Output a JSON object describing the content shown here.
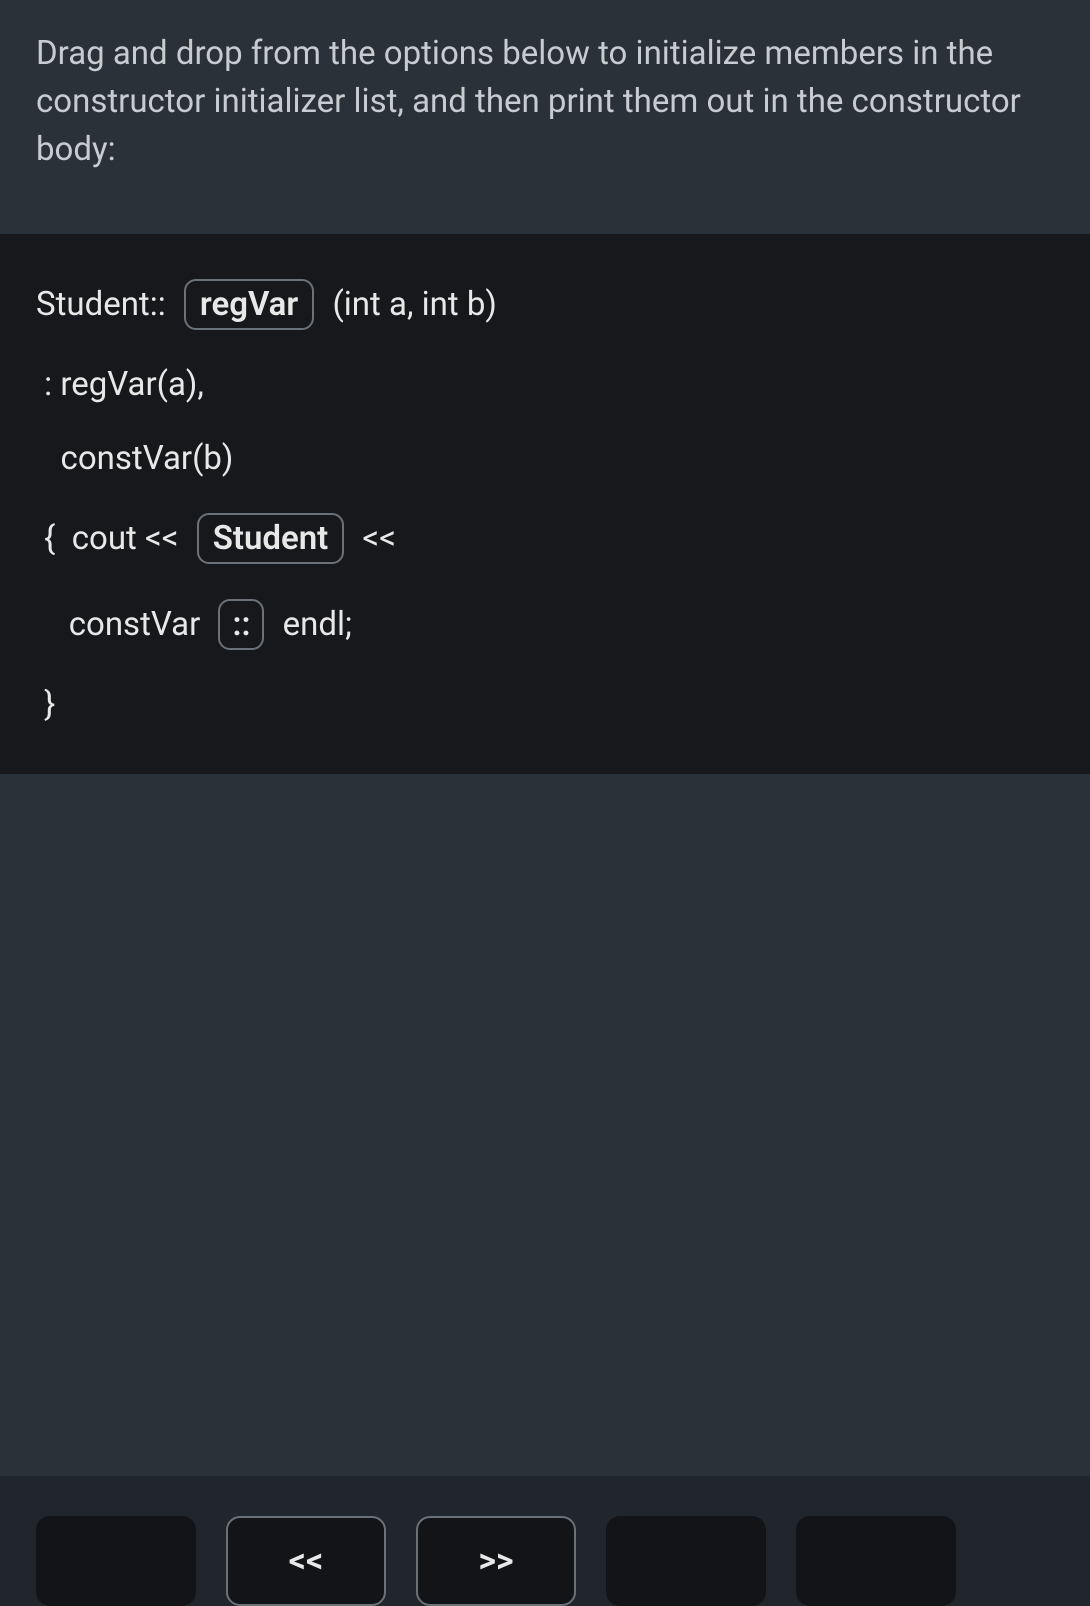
{
  "instruction": "Drag and drop from the options below to initialize members in the constructor initializer list, and then print them out in the constructor body:",
  "code": {
    "line1_pre": "Student:: ",
    "line1_token": "regVar",
    "line1_post": " (int a, int b)",
    "line2": " : regVar(a),",
    "line3": "   constVar(b)",
    "line4_pre": " {  cout << ",
    "line4_token": "Student",
    "line4_post": " <<",
    "line5_pre": "    constVar ",
    "line5_token": "::",
    "line5_post": " endl;",
    "line6": " }"
  },
  "options": {
    "opt1": "",
    "opt2": "<<",
    "opt3": ">>",
    "opt4": "",
    "opt5": ""
  }
}
